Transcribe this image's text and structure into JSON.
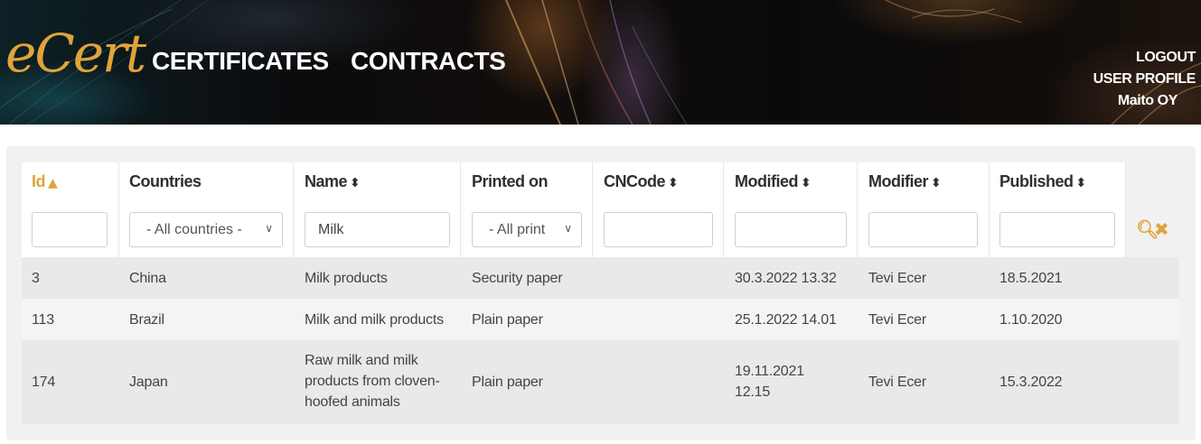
{
  "header": {
    "logo": "eCert",
    "nav": [
      "CERTIFICATES",
      "CONTRACTS"
    ],
    "user_menu": {
      "logout": "LOGOUT",
      "profile": "USER PROFILE",
      "company": "Maito OY"
    }
  },
  "colors": {
    "accent": "#e0a43a",
    "header_bg": "#0b0b0d"
  },
  "table": {
    "columns": [
      {
        "label": "Id",
        "sort": "asc",
        "active": true
      },
      {
        "label": "Countries",
        "sort": null
      },
      {
        "label": "Name",
        "sort": "both"
      },
      {
        "label": "Printed on",
        "sort": null
      },
      {
        "label": "CNCode",
        "sort": "both"
      },
      {
        "label": "Modified",
        "sort": "both"
      },
      {
        "label": "Modifier",
        "sort": "both"
      },
      {
        "label": "Published",
        "sort": "both"
      }
    ],
    "filters": {
      "id": "",
      "countries": "- All countries -",
      "name": "Milk",
      "printed_on": "- All print",
      "cncode": "",
      "modified": "",
      "modifier": "",
      "published": ""
    },
    "actions": {
      "search_icon": "search-icon",
      "clear_icon": "close-icon"
    },
    "rows": [
      {
        "id": "3",
        "country": "China",
        "name": "Milk products",
        "printed": "Security paper",
        "cncode": "",
        "modified": "30.3.2022 13.32",
        "modifier": "Tevi Ecer",
        "published": "18.5.2021"
      },
      {
        "id": "113",
        "country": "Brazil",
        "name": "Milk and milk products",
        "printed": "Plain paper",
        "cncode": "",
        "modified": "25.1.2022 14.01",
        "modifier": "Tevi Ecer",
        "published": "1.10.2020"
      },
      {
        "id": "174",
        "country": "Japan",
        "name": "Raw milk and milk\nproducts from cloven-\nhoofed animals",
        "printed": "Plain paper",
        "cncode": "",
        "modified": "19.11.2021\n12.15",
        "modifier": "Tevi Ecer",
        "published": "15.3.2022"
      }
    ]
  }
}
